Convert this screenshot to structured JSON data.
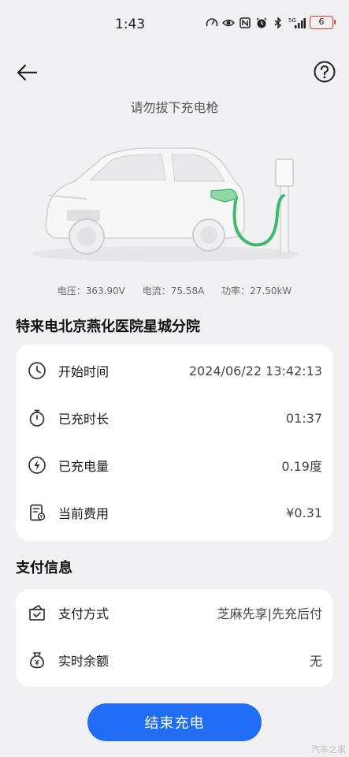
{
  "status_bar": {
    "time": "1:43",
    "battery_level": "6",
    "network": "5G",
    "icons": [
      "speed-icon",
      "eye-icon",
      "nfc-icon",
      "alarm-icon",
      "bluetooth-icon",
      "signal-icon",
      "battery-icon"
    ]
  },
  "header": {
    "back_icon": "back-arrow-icon",
    "help_icon": "help-icon",
    "subtitle": "请勿拔下充电枪"
  },
  "metrics": {
    "voltage": "电压：363.90V",
    "current": "电流：75.58A",
    "power": "功率：27.50kW"
  },
  "station": {
    "name": "特来电北京燕化医院星城分院"
  },
  "charging": {
    "rows": [
      {
        "icon": "clock-icon",
        "label": "开始时间",
        "value": "2024/06/22 13:42:13"
      },
      {
        "icon": "stopwatch-icon",
        "label": "已充时长",
        "value": "01:37"
      },
      {
        "icon": "lightning-icon",
        "label": "已充电量",
        "value": "0.19度"
      },
      {
        "icon": "bill-icon",
        "label": "当前费用",
        "value": "¥0.31"
      }
    ]
  },
  "payment": {
    "title": "支付信息",
    "rows": [
      {
        "icon": "wallet-icon",
        "label": "支付方式",
        "value": "芝麻先享|先充后付"
      },
      {
        "icon": "money-bag-icon",
        "label": "实时余额",
        "value": "无"
      }
    ]
  },
  "actions": {
    "end_label": "结束充电"
  },
  "watermark": "汽车之家",
  "colors": {
    "accent": "#1f6ef5",
    "charging_cable": "#3dbb6a",
    "background": "#f1f1f3",
    "battery_low": "#d93b30"
  }
}
